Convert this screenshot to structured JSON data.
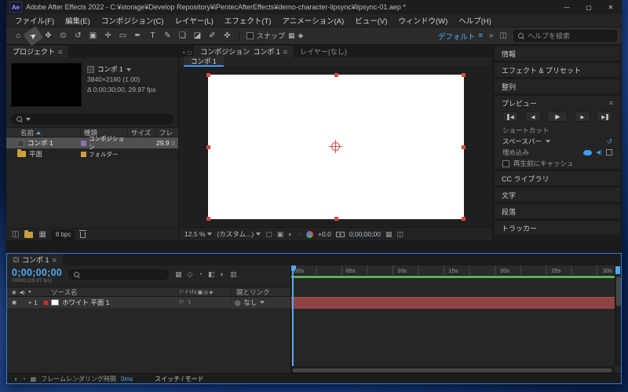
{
  "window": {
    "app_badge": "Ae",
    "title": "Adobe After Effects 2022 - C:¥storage¥Develop Repository¥iPentecAfterEffects¥demo-character-lipsync¥lipsync-01.aep *",
    "minimize": "—",
    "maximize": "▢",
    "close": "✕"
  },
  "menubar": {
    "items": [
      "ファイル(F)",
      "編集(E)",
      "コンポジション(C)",
      "レイヤー(L)",
      "エフェクト(T)",
      "アニメーション(A)",
      "ビュー(V)",
      "ウィンドウ(W)",
      "ヘルプ(H)"
    ]
  },
  "toolbar": {
    "tools": [
      {
        "name": "home",
        "glyph": "⌂"
      },
      {
        "name": "selection",
        "glyph": "➤"
      },
      {
        "name": "hand",
        "glyph": "✥"
      },
      {
        "name": "zoom",
        "glyph": "⊙"
      },
      {
        "name": "rotation",
        "glyph": "↺"
      },
      {
        "name": "camera",
        "glyph": "▣"
      },
      {
        "name": "pan-behind",
        "glyph": "✛"
      },
      {
        "name": "shape",
        "glyph": "▭"
      },
      {
        "name": "pen",
        "glyph": "✒"
      },
      {
        "name": "text",
        "glyph": "T"
      },
      {
        "name": "brush",
        "glyph": "✎"
      },
      {
        "name": "clone-stamp",
        "glyph": "❏"
      },
      {
        "name": "eraser",
        "glyph": "◪"
      },
      {
        "name": "roto-brush",
        "glyph": "✐"
      },
      {
        "name": "puppet",
        "glyph": "✜"
      }
    ],
    "snap_label": "スナップ",
    "workspace_label": "デフォルト",
    "overflow_chevrons": "»",
    "search_placeholder": "ヘルプを検索"
  },
  "project": {
    "tab_label": "プロジェクト",
    "preview_name": "コンポ 1",
    "preview_resolution": "3840×2160 (1.00)",
    "preview_duration": "Δ 0;00;30;00, 29.97 fps",
    "col_name": "名前",
    "col_type": "種類",
    "col_size": "サイズ",
    "col_fps": "フレ",
    "rows": [
      {
        "name": "コンポ 1",
        "type": "コンポジション",
        "fps": "29.9"
      },
      {
        "name": "平面",
        "type": "フォルダー",
        "fps": ""
      }
    ],
    "bpc_label": "8 bpc"
  },
  "viewer": {
    "panel_label": "コンポジション",
    "comp_name": "コンポ 1",
    "layer_tab_label": "レイヤー(なし)",
    "viewer_tab": "コンポ 1",
    "zoom_value": "12.5 %",
    "resolution_value": "(カスタム...)",
    "exposure_value": "+0.0",
    "timecode": "0;00;00;00"
  },
  "sidebar": {
    "info_label": "情報",
    "effects_label": "エフェクト & プリセット",
    "align_label": "整列",
    "preview_label": "プレビュー",
    "shortcut_label": "ショートカット",
    "shortcut_value": "スペースバー",
    "include_label": "埋め込み",
    "cache_label": "再生前にキャッシュ",
    "cc_label": "CC ライブラリ",
    "character_label": "文字",
    "paragraph_label": "段落",
    "tracker_label": "トラッカー",
    "transport": [
      "▌◀",
      "◀",
      "▶",
      "▶",
      "▶▐"
    ]
  },
  "timeline": {
    "tab_label": "コンポ 1",
    "timecode": "0;00;00;00",
    "frame_info": "00000 (29.97 fps)",
    "col_source": "ソース名",
    "col_switches": "⚐⚡\\fx▣◎◈",
    "col_parent": "親とリンク",
    "layer_index": "1",
    "layer_name": "ホワイト 平面 1",
    "layer_parent": "なし",
    "ruler": [
      "00s",
      "05s",
      "10s",
      "15s",
      "20s",
      "25s",
      "30s"
    ],
    "render_label": "フレームレンダリング時間",
    "render_value": "0ms",
    "switch_mode_label": "スイッチ / モード"
  },
  "icons": {
    "menu": "≡",
    "panel_box": "◫",
    "snap_a": "▦",
    "snap_b": "◈",
    "eye": "◉",
    "audio": "◀)",
    "solo": "●",
    "twirl": "▸",
    "pickwhip": "◎",
    "reset": "↺",
    "group": "▪",
    "lock": "◻",
    "interpret": "◫",
    "new_comp": "▦",
    "view_opt1": "▢",
    "view_opt2": "▣",
    "view_opt3": "◐",
    "view_opt4": "◌",
    "view_grid": "▦",
    "view_flow": "◫",
    "tl1": "▦",
    "tl2": "◇",
    "tl3": "◔",
    "tl4": "◧",
    "tl5": "◐",
    "tl6": "▥",
    "tf1": "◑",
    "tf2": "◔",
    "tf3": "▦"
  }
}
